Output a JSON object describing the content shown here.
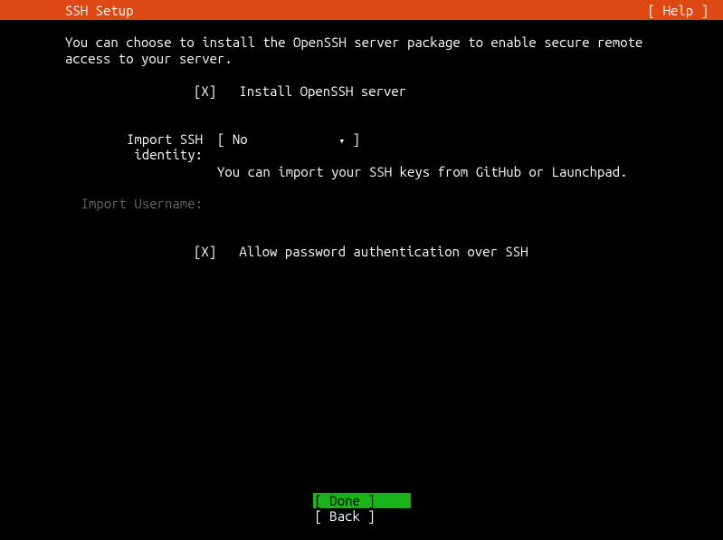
{
  "header": {
    "title": "SSH Setup",
    "help": "[ Help ]"
  },
  "description": "You can choose to install the OpenSSH server package to enable secure remote access to your server.",
  "install_checkbox": {
    "marker": "[X]",
    "label": "Install OpenSSH server"
  },
  "import_identity": {
    "label": "Import SSH identity:",
    "dropdown_open": "[ ",
    "dropdown_value": "No",
    "dropdown_arrow": "▾",
    "dropdown_close": " ]",
    "help_text": "You can import your SSH keys from GitHub or Launchpad."
  },
  "import_username": {
    "label": "Import Username:"
  },
  "allow_password": {
    "marker": "[X]",
    "label": "Allow password authentication over SSH"
  },
  "footer": {
    "done": "[ Done       ]",
    "back": "[ Back       ]"
  }
}
